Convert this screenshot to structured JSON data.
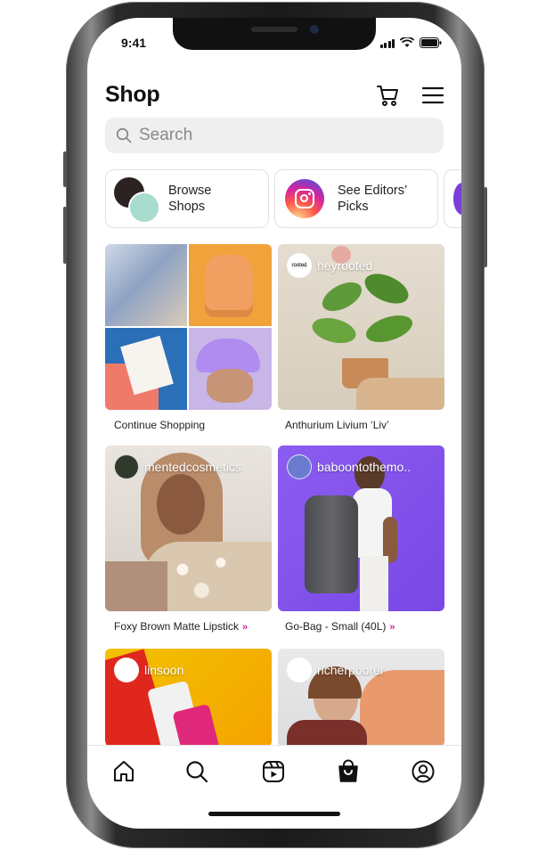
{
  "status": {
    "time": "9:41"
  },
  "header": {
    "title": "Shop"
  },
  "search": {
    "placeholder": "Search"
  },
  "chips": [
    {
      "label_line1": "Browse",
      "label_line2": "Shops"
    },
    {
      "label_line1": "See Editors’",
      "label_line2": "Picks"
    }
  ],
  "tiles": [
    {
      "caption": "Continue Shopping",
      "handle": ""
    },
    {
      "caption": "Anthurium Livium ‘Liv’",
      "handle": "heyrooted",
      "avatar_text": "rooted"
    },
    {
      "caption": "Foxy Brown Matte Lipstick",
      "handle": "mentedcosmetics",
      "arrow": "»"
    },
    {
      "caption": "Go-Bag - Small (40L)",
      "handle": "baboontothemo..",
      "arrow": "»"
    },
    {
      "caption": "",
      "handle": "linsoon"
    },
    {
      "caption": "",
      "handle": "richerpoorer"
    }
  ],
  "tabbar": {
    "items": [
      "home-icon",
      "search-icon",
      "reels-icon",
      "shop-icon",
      "profile-icon"
    ]
  },
  "colors": {
    "accent_pink": "#d6249f",
    "search_bg": "#efefef"
  }
}
